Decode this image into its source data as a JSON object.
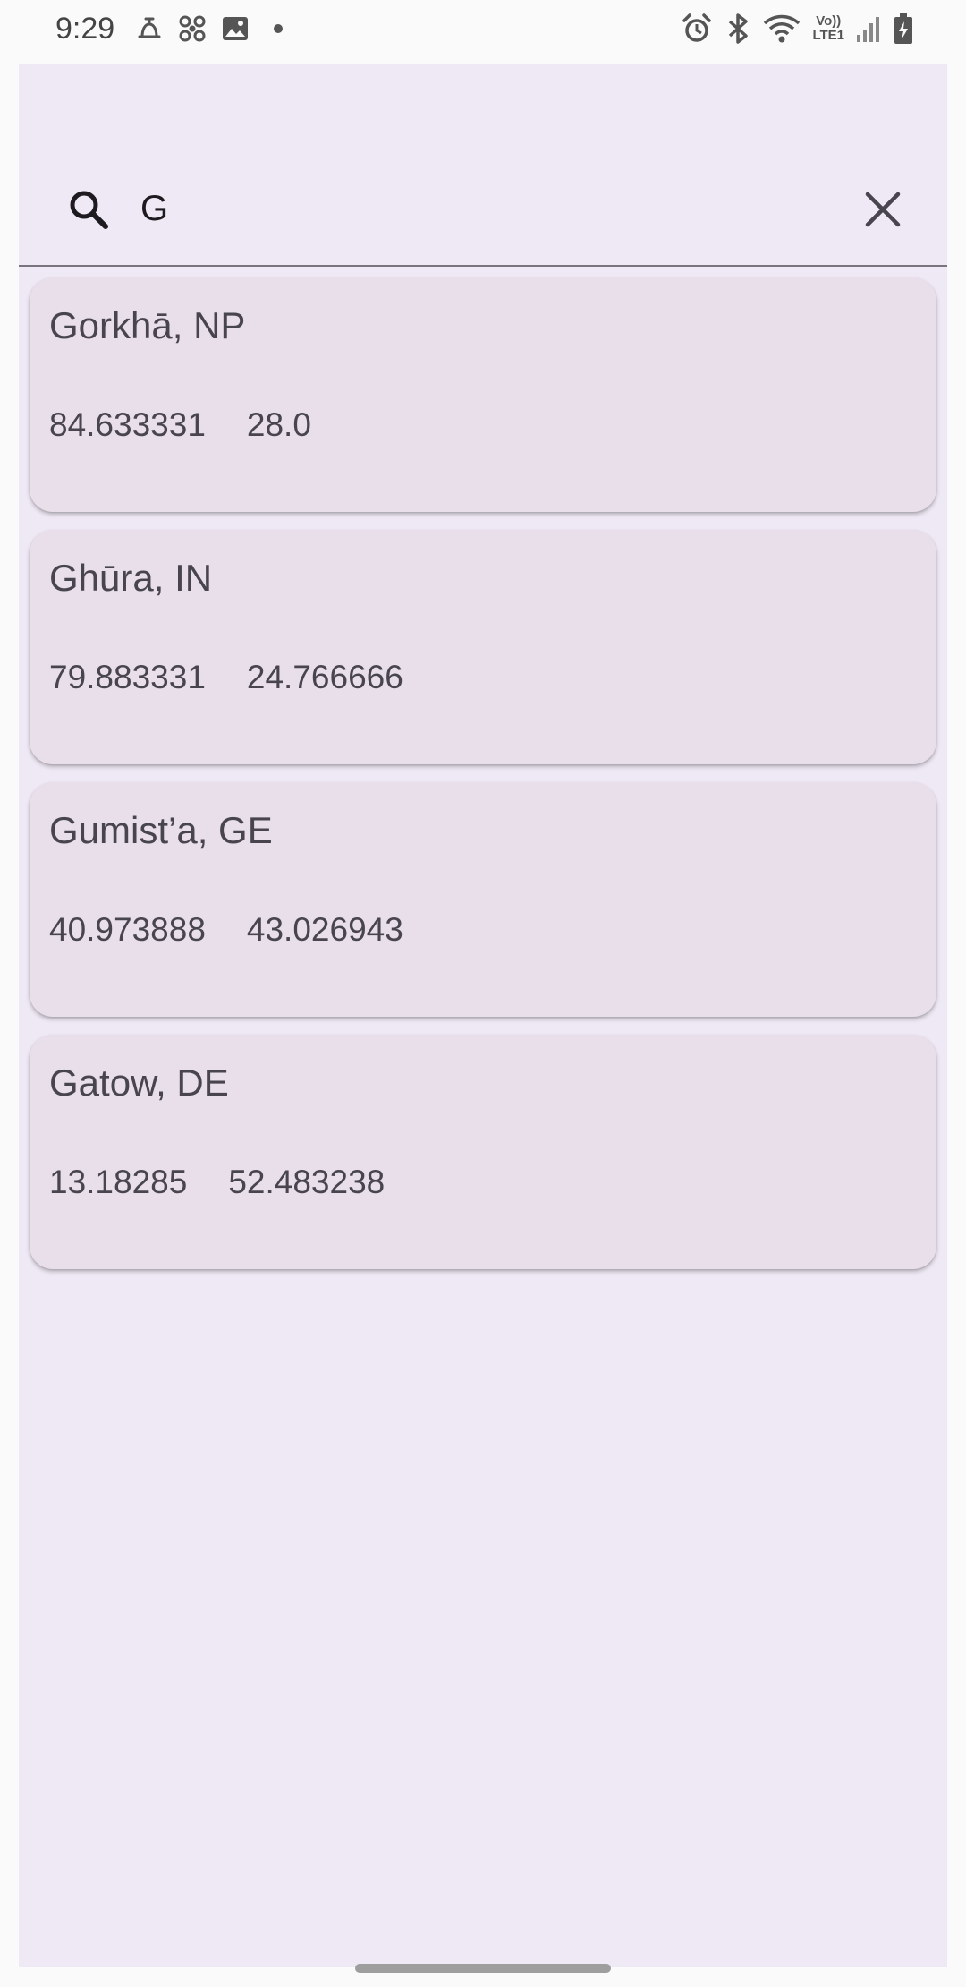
{
  "status_bar": {
    "time": "9:29",
    "left_icons": [
      "ringer-icon",
      "fan-icon",
      "image-icon",
      "dot-icon"
    ],
    "right_icons": [
      "alarm-icon",
      "bluetooth-icon",
      "wifi-icon",
      "volte-icon",
      "signal-icon",
      "battery-icon"
    ],
    "volte_top": "Vo))",
    "volte_bottom": "LTE1"
  },
  "search": {
    "value": "G",
    "placeholder": ""
  },
  "results": [
    {
      "title": "Gorkhā, NP",
      "lon": "84.633331",
      "lat": "28.0"
    },
    {
      "title": "Ghūra, IN",
      "lon": "79.883331",
      "lat": "24.766666"
    },
    {
      "title": "Gumist’a, GE",
      "lon": "40.973888",
      "lat": "43.026943"
    },
    {
      "title": "Gatow, DE",
      "lon": "13.18285",
      "lat": "52.483238"
    }
  ],
  "colors": {
    "surface": "#efe9f5",
    "card": "#e8dfea",
    "text": "#49454f"
  }
}
